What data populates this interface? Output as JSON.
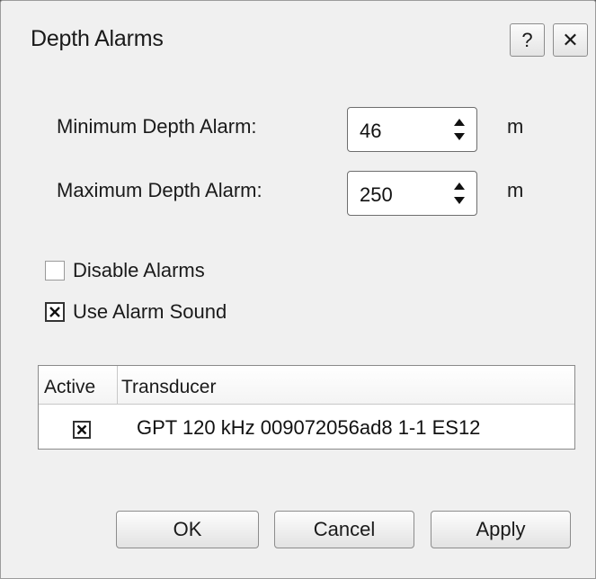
{
  "dialog": {
    "title": "Depth Alarms",
    "help_label": "?",
    "close_label": "✕"
  },
  "fields": {
    "min": {
      "label": "Minimum Depth Alarm:",
      "value": "46",
      "unit": "m"
    },
    "max": {
      "label": "Maximum Depth Alarm:",
      "value": "250",
      "unit": "m"
    }
  },
  "options": {
    "disable_alarms": {
      "label": "Disable Alarms",
      "checked": false
    },
    "use_alarm_sound": {
      "label": "Use Alarm Sound",
      "checked": true
    }
  },
  "table": {
    "headers": [
      "Active",
      "Transducer"
    ],
    "rows": [
      {
        "active": true,
        "transducer": "GPT 120 kHz 009072056ad8 1-1 ES12"
      }
    ]
  },
  "buttons": {
    "ok": "OK",
    "cancel": "Cancel",
    "apply": "Apply"
  },
  "icons": {
    "spin": "spin-arrows-icon",
    "check": "check-x-icon"
  }
}
